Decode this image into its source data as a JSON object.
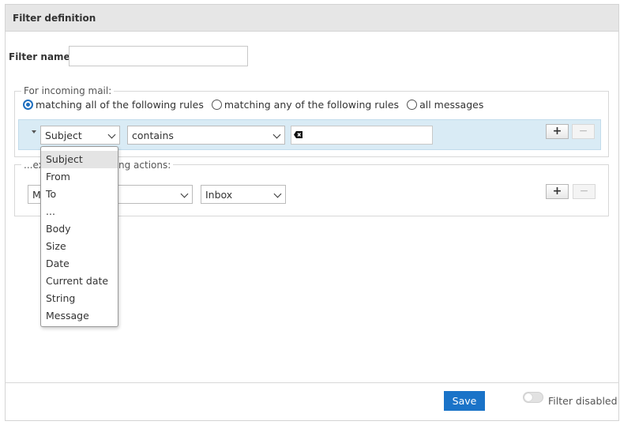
{
  "header": {
    "title": "Filter definition"
  },
  "filter_name": {
    "label": "Filter name:",
    "value": ""
  },
  "incoming": {
    "legend": "For incoming mail:",
    "radios": [
      {
        "label": "matching all of the following rules",
        "checked": true
      },
      {
        "label": "matching any of the following rules",
        "checked": false
      },
      {
        "label": "all messages",
        "checked": false
      }
    ]
  },
  "rule": {
    "header_value": "Subject",
    "operator_value": "contains",
    "text_value": "",
    "add_label": "+",
    "remove_label": "−"
  },
  "actions": {
    "legend_prefix": "...ex",
    "legend_suffix": "ng actions:",
    "action_value_visible": "M",
    "folder_value": "Inbox",
    "add_label": "+",
    "remove_label": "−"
  },
  "dropdown": {
    "options": [
      "Subject",
      "From",
      "To",
      "...",
      "Body",
      "Size",
      "Date",
      "Current date",
      "String",
      "Message"
    ],
    "selected": "Subject"
  },
  "footer": {
    "save_label": "Save",
    "toggle_label": "Filter disabled",
    "filter_disabled": false
  },
  "colors": {
    "accent": "#1a73c8",
    "rule_row_bg": "#d9ebf5",
    "header_bg": "#e6e6e6"
  }
}
